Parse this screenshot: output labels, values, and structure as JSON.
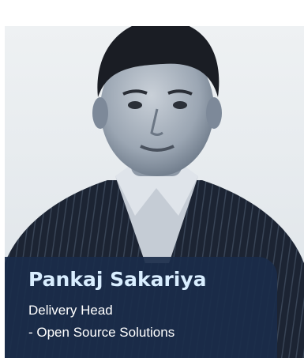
{
  "profile": {
    "name": "Pankaj Sakariya",
    "title_line1": "Delivery Head",
    "title_line2": "- Open Source Solutions"
  },
  "colors": {
    "caption_bg": "#1a2c4a",
    "name_text": "#d9eeff",
    "role_text": "#ffffff",
    "photo_bg": "#e9edf0"
  }
}
